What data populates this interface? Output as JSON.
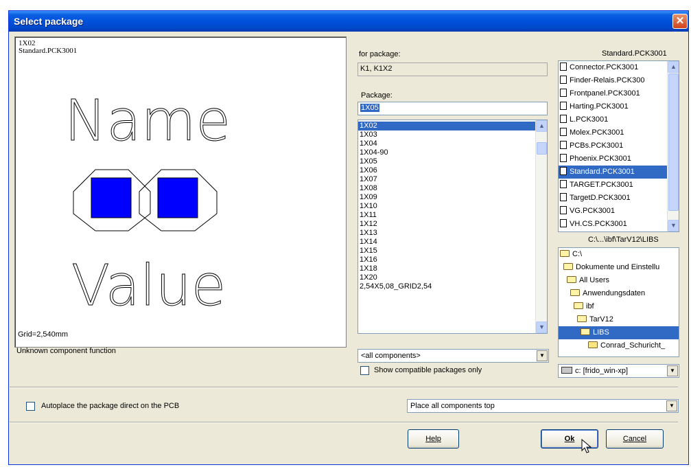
{
  "window": {
    "title": "Select package",
    "close_glyph": "✕"
  },
  "preview": {
    "name": "1X02",
    "library": "Standard.PCK3001",
    "grid": "Grid=2,540mm",
    "function": "Unknown component function",
    "name_placeholder": "Name",
    "value_placeholder": "Value",
    "pad_color": "#0000ff"
  },
  "for_package": {
    "label": "for package:",
    "value": "K1, K1X2"
  },
  "package": {
    "label": "Package:",
    "value": "1X05",
    "items": [
      "1X02",
      "1X03",
      "1X04",
      "1X04-90",
      "1X05",
      "1X06",
      "1X07",
      "1X08",
      "1X09",
      "1X10",
      "1X11",
      "1X12",
      "1X13",
      "1X14",
      "1X15",
      "1X16",
      "1X18",
      "1X20",
      "2,54X5,08_GRID2,54"
    ],
    "selected": "1X02"
  },
  "filter": {
    "value": "<all components>",
    "compatible_label": "Show compatible packages only"
  },
  "libraries": {
    "current": "Standard.PCK3001",
    "items": [
      "Connector.PCK3001",
      "Finder-Relais.PCK300",
      "Frontpanel.PCK3001",
      "Harting.PCK3001",
      "L.PCK3001",
      "Molex.PCK3001",
      "PCBs.PCK3001",
      "Phoenix.PCK3001",
      "Standard.PCK3001",
      "TARGET.PCK3001",
      "TargetD.PCK3001",
      "VG.PCK3001",
      "VH.CS.PCK3001"
    ],
    "selected": "Standard.PCK3001"
  },
  "folders": {
    "path": "C:\\...\\ibf\\TarV12\\LIBS",
    "items": [
      "C:\\",
      "Dokumente und Einstellu",
      "All Users",
      "Anwendungsdaten",
      "ibf",
      "TarV12",
      "LIBS",
      "Conrad_Schuricht_"
    ],
    "selected": "LIBS"
  },
  "drive": {
    "value": "c: [frido_win-xp]"
  },
  "autoplace": {
    "label": "Autoplace the package direct on the PCB"
  },
  "placement": {
    "value": "Place all components top"
  },
  "buttons": {
    "help": "Help",
    "ok": "Ok",
    "cancel": "Cancel"
  },
  "colors": {
    "title_bar": "#0050dc",
    "selection": "#316ac5",
    "face": "#ece9d8"
  }
}
